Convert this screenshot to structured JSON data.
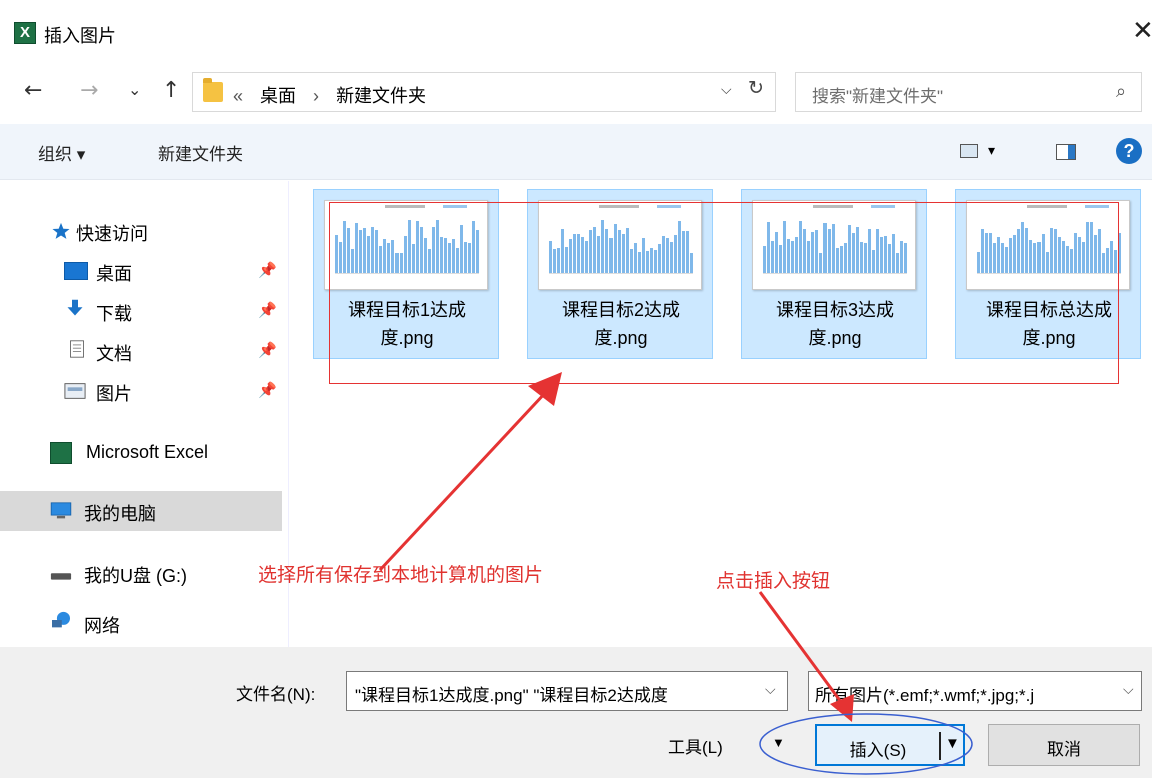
{
  "window": {
    "title": "插入图片",
    "app_icon_letter": "X",
    "close_glyph": "✕"
  },
  "nav": {
    "back": "←",
    "forward": "→",
    "recent": "⌄",
    "up": "↑"
  },
  "address": {
    "overflow": "«",
    "crumbs": [
      "桌面",
      "›",
      "新建文件夹"
    ],
    "dropdown": "⌵",
    "refresh": "↻"
  },
  "search": {
    "placeholder": "搜索\"新建文件夹\"",
    "icon": "⌕"
  },
  "toolbar": {
    "organize": "组织 ▾",
    "new_folder": "新建文件夹",
    "view_dd": "▾",
    "help": "?"
  },
  "sidebar": {
    "quick_access": "快速访问",
    "items": [
      {
        "label": "桌面",
        "icon": "desktop-icon",
        "pinned": true
      },
      {
        "label": "下载",
        "icon": "download-icon",
        "pinned": true
      },
      {
        "label": "文档",
        "icon": "document-icon",
        "pinned": true
      },
      {
        "label": "图片",
        "icon": "pictures-icon",
        "pinned": true
      }
    ],
    "excel": "Microsoft Excel",
    "this_pc": "我的电脑",
    "usb": "我的U盘 (G:)",
    "network": "网络",
    "pin_glyph": "📌"
  },
  "files": [
    {
      "line1": "课程目标1达成",
      "line2": "度.png"
    },
    {
      "line1": "课程目标2达成",
      "line2": "度.png"
    },
    {
      "line1": "课程目标3达成",
      "line2": "度.png"
    },
    {
      "line1": "课程目标总达成",
      "line2": "度.png"
    }
  ],
  "annotations": {
    "select_all": "选择所有保存到本地计算机的图片",
    "click_insert": "点击插入按钮",
    "color": "#e53333",
    "circle_color": "#3a5fd0"
  },
  "footer": {
    "filename_label": "文件名(N):",
    "filename_value": "\"课程目标1达成度.png\" \"课程目标2达成度",
    "filetype_value": "所有图片(*.emf;*.wmf;*.jpg;*.j",
    "dd": "⌵",
    "tools": "工具(L)",
    "tools_dd": "▼",
    "insert": "插入(S)",
    "insert_dd": "▼",
    "cancel": "取消"
  }
}
